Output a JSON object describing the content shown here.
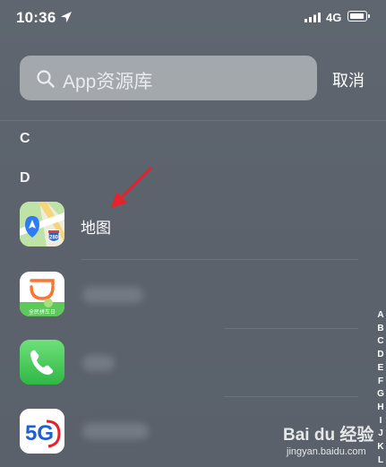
{
  "status_bar": {
    "time": "10:36",
    "network": "4G"
  },
  "search": {
    "placeholder": "App资源库",
    "cancel_label": "取消"
  },
  "sections": [
    "C",
    "D"
  ],
  "apps": [
    {
      "name": "地图",
      "icon": "maps-icon"
    },
    {
      "name": "",
      "icon": "didi-icon",
      "badge_text": "全民拼车日"
    },
    {
      "name": "",
      "icon": "phone-icon"
    },
    {
      "name": "",
      "icon": "china-unicom-5g-icon",
      "badge_text": "5G"
    }
  ],
  "alphabet_index": [
    "A",
    "B",
    "C",
    "D",
    "E",
    "F",
    "G",
    "H",
    "I",
    "J",
    "K",
    "L"
  ],
  "watermark": {
    "main": "Bai du 经验",
    "sub": "jingyan.baidu.com"
  },
  "colors": {
    "background": "#5e656e",
    "search_field": "#a3a8ad",
    "annotation_arrow": "#e8222c"
  }
}
